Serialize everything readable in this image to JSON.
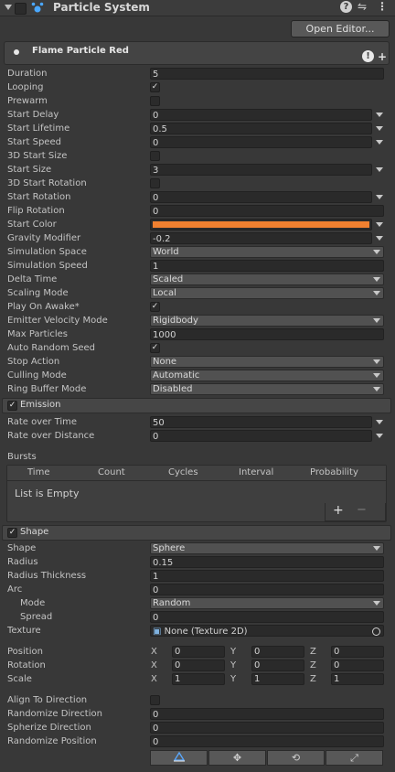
{
  "header": {
    "title": "Particle System"
  },
  "open_editor": "Open Editor...",
  "system_name": "Flame Particle Red",
  "main": [
    {
      "label": "Duration",
      "type": "field",
      "value": "5"
    },
    {
      "label": "Looping",
      "type": "check",
      "value": true
    },
    {
      "label": "Prewarm",
      "type": "check",
      "value": false
    },
    {
      "label": "Start Delay",
      "type": "fieldx",
      "value": "0"
    },
    {
      "label": "Start Lifetime",
      "type": "fieldx",
      "value": "0.5"
    },
    {
      "label": "Start Speed",
      "type": "fieldx",
      "value": "0"
    },
    {
      "label": "3D Start Size",
      "type": "check",
      "value": false
    },
    {
      "label": "Start Size",
      "type": "fieldx",
      "value": "3"
    },
    {
      "label": "3D Start Rotation",
      "type": "check",
      "value": false
    },
    {
      "label": "Start Rotation",
      "type": "fieldx",
      "value": "0"
    },
    {
      "label": "Flip Rotation",
      "type": "field",
      "value": "0"
    },
    {
      "label": "Start Color",
      "type": "color",
      "value": "#f08030"
    },
    {
      "label": "Gravity Modifier",
      "type": "fieldx",
      "value": "-0.2"
    },
    {
      "label": "Simulation Space",
      "type": "dropdown",
      "value": "World"
    },
    {
      "label": "Simulation Speed",
      "type": "field",
      "value": "1"
    },
    {
      "label": "Delta Time",
      "type": "dropdown",
      "value": "Scaled"
    },
    {
      "label": "Scaling Mode",
      "type": "dropdown",
      "value": "Local"
    },
    {
      "label": "Play On Awake*",
      "type": "check",
      "value": true
    },
    {
      "label": "Emitter Velocity Mode",
      "type": "dropdown",
      "value": "Rigidbody"
    },
    {
      "label": "Max Particles",
      "type": "field",
      "value": "1000"
    },
    {
      "label": "Auto Random Seed",
      "type": "check",
      "value": true
    },
    {
      "label": "Stop Action",
      "type": "dropdown",
      "value": "None"
    },
    {
      "label": "Culling Mode",
      "type": "dropdown",
      "value": "Automatic"
    },
    {
      "label": "Ring Buffer Mode",
      "type": "dropdown",
      "value": "Disabled"
    }
  ],
  "emission": {
    "title": "Emission",
    "rows": [
      {
        "label": "Rate over Time",
        "type": "fieldx",
        "value": "50"
      },
      {
        "label": "Rate over Distance",
        "type": "fieldx",
        "value": "0"
      }
    ],
    "bursts_label": "Bursts",
    "burst_columns": [
      "Time",
      "Count",
      "Cycles",
      "Interval",
      "Probability"
    ],
    "empty": "List is Empty",
    "add": "+",
    "remove": "−"
  },
  "shape": {
    "title": "Shape",
    "rows": [
      {
        "label": "Shape",
        "type": "dropdown",
        "value": "Sphere"
      },
      {
        "label": "Radius",
        "type": "field",
        "value": "0.15"
      },
      {
        "label": "Radius Thickness",
        "type": "field",
        "value": "1"
      },
      {
        "label": "Arc",
        "type": "field",
        "value": "0"
      },
      {
        "label": "Mode",
        "type": "dropdown",
        "value": "Random",
        "indent": true
      },
      {
        "label": "Spread",
        "type": "field",
        "value": "0",
        "indent": true
      },
      {
        "label": "Texture",
        "type": "object",
        "value": "None (Texture 2D)"
      }
    ],
    "vectors": [
      {
        "label": "Position",
        "x": "0",
        "y": "0",
        "z": "0"
      },
      {
        "label": "Rotation",
        "x": "0",
        "y": "0",
        "z": "0"
      },
      {
        "label": "Scale",
        "x": "1",
        "y": "1",
        "z": "1"
      }
    ],
    "rows2": [
      {
        "label": "Align To Direction",
        "type": "check",
        "value": false
      },
      {
        "label": "Randomize Direction",
        "type": "field",
        "value": "0"
      },
      {
        "label": "Spherize Direction",
        "type": "field",
        "value": "0"
      },
      {
        "label": "Randomize Position",
        "type": "field",
        "value": "0"
      }
    ],
    "axis": {
      "x": "X",
      "y": "Y",
      "z": "Z"
    }
  },
  "icons": [
    "edit-shape-icon",
    "move-icon",
    "rotate-icon",
    "scale-icon"
  ]
}
